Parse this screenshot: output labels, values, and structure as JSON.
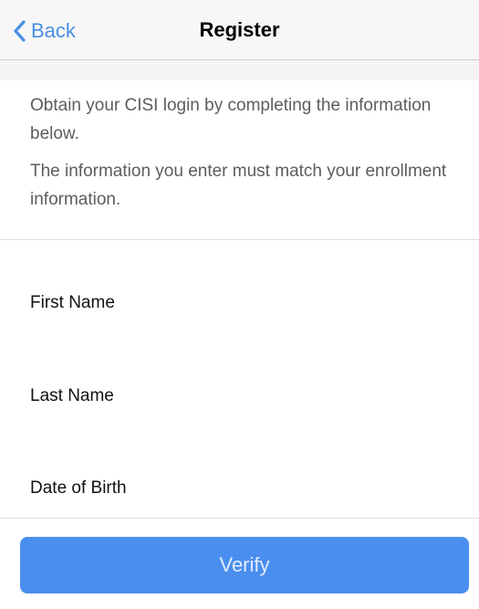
{
  "navbar": {
    "back_label": "Back",
    "title": "Register"
  },
  "intro": {
    "line1": "Obtain your CISI login by completing the information below.",
    "line2": "The information you enter must match your enrollment information."
  },
  "form": {
    "first_name_label": "First Name",
    "last_name_label": "Last Name",
    "dob_label": "Date of Birth",
    "first_name_value": "",
    "last_name_value": ""
  },
  "verify_label": "Verify",
  "colors": {
    "accent": "#4a8fe2",
    "button": "#4a8fef"
  }
}
